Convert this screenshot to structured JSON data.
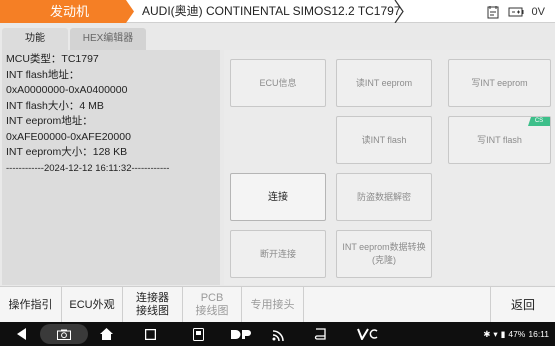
{
  "header": {
    "module": "发动机",
    "vehicle": "AUDI(奥迪) CONTINENTAL SIMOS12.2 TC1797",
    "voltage": "0V",
    "icons": [
      "report-icon",
      "battery-icon"
    ]
  },
  "tabs": [
    {
      "label": "功能",
      "active": true
    },
    {
      "label": "HEX编辑器",
      "active": false
    }
  ],
  "info_lines": [
    "MCU类型：TC1797",
    "INT flash地址：",
    "0xA0000000-0xA0400000",
    "INT flash大小：4 MB",
    "INT eeprom地址：",
    "0xAFE00000-0xAFE20000",
    "INT eeprom大小：128 KB",
    "------------2024-12-12 16:11:32------------"
  ],
  "buttons": {
    "ecu_info": "ECU信息",
    "read_eeprom": "读INT eeprom",
    "write_eeprom": "写INT eeprom",
    "read_flash": "读INT flash",
    "write_flash": "写INT flash",
    "write_flash_badge": "CS",
    "connect": "连接",
    "anti_theft": "防盗数据解密",
    "disconnect": "断开连接",
    "eeprom_convert_line1": "INT eeprom数据转换",
    "eeprom_convert_line2": "(克隆)"
  },
  "footer": {
    "guide": "操作指引",
    "ecu_appearance": "ECU外观",
    "connector_line1": "连接器",
    "connector_line2": "接线图",
    "pcb_line1": "PCB",
    "pcb_line2": "接线图",
    "special_connector": "专用接头",
    "back": "返回"
  },
  "statusbar": {
    "battery": "47%",
    "time": "16:11"
  }
}
